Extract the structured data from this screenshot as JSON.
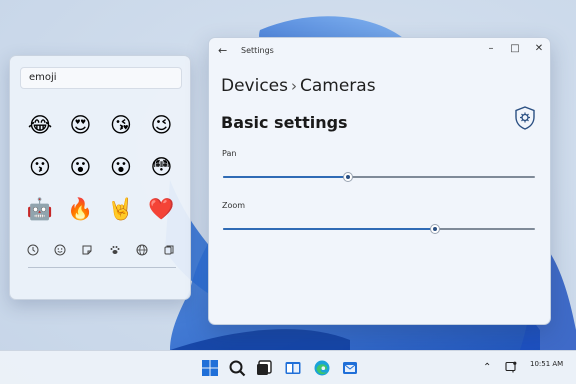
{
  "emoji_panel": {
    "search_value": "emoji",
    "emojis": [
      "😂",
      "😍",
      "😘",
      "😉",
      "😗",
      "😮",
      "😮",
      "😳",
      "🤖",
      "🔥",
      "🤘",
      "❤️"
    ],
    "categories": [
      "recent-icon",
      "smiley-icon",
      "sticker-icon",
      "paw-icon",
      "globe-icon",
      "clipboard-icon"
    ]
  },
  "settings": {
    "window_title": "Settings",
    "breadcrumb": {
      "parent": "Devices",
      "separator": "›",
      "current": "Cameras"
    },
    "section_title": "Basic settings",
    "pan": {
      "label": "Pan",
      "value": 0.4
    },
    "zoom": {
      "label": "Zoom",
      "value": 0.68
    },
    "accent_color": "#2f6bb5"
  },
  "taskbar": {
    "apps": [
      "start-icon",
      "search-icon",
      "task-view-icon",
      "file-explorer-icon",
      "edge-icon",
      "mail-icon"
    ],
    "time": "10:51 AM"
  }
}
